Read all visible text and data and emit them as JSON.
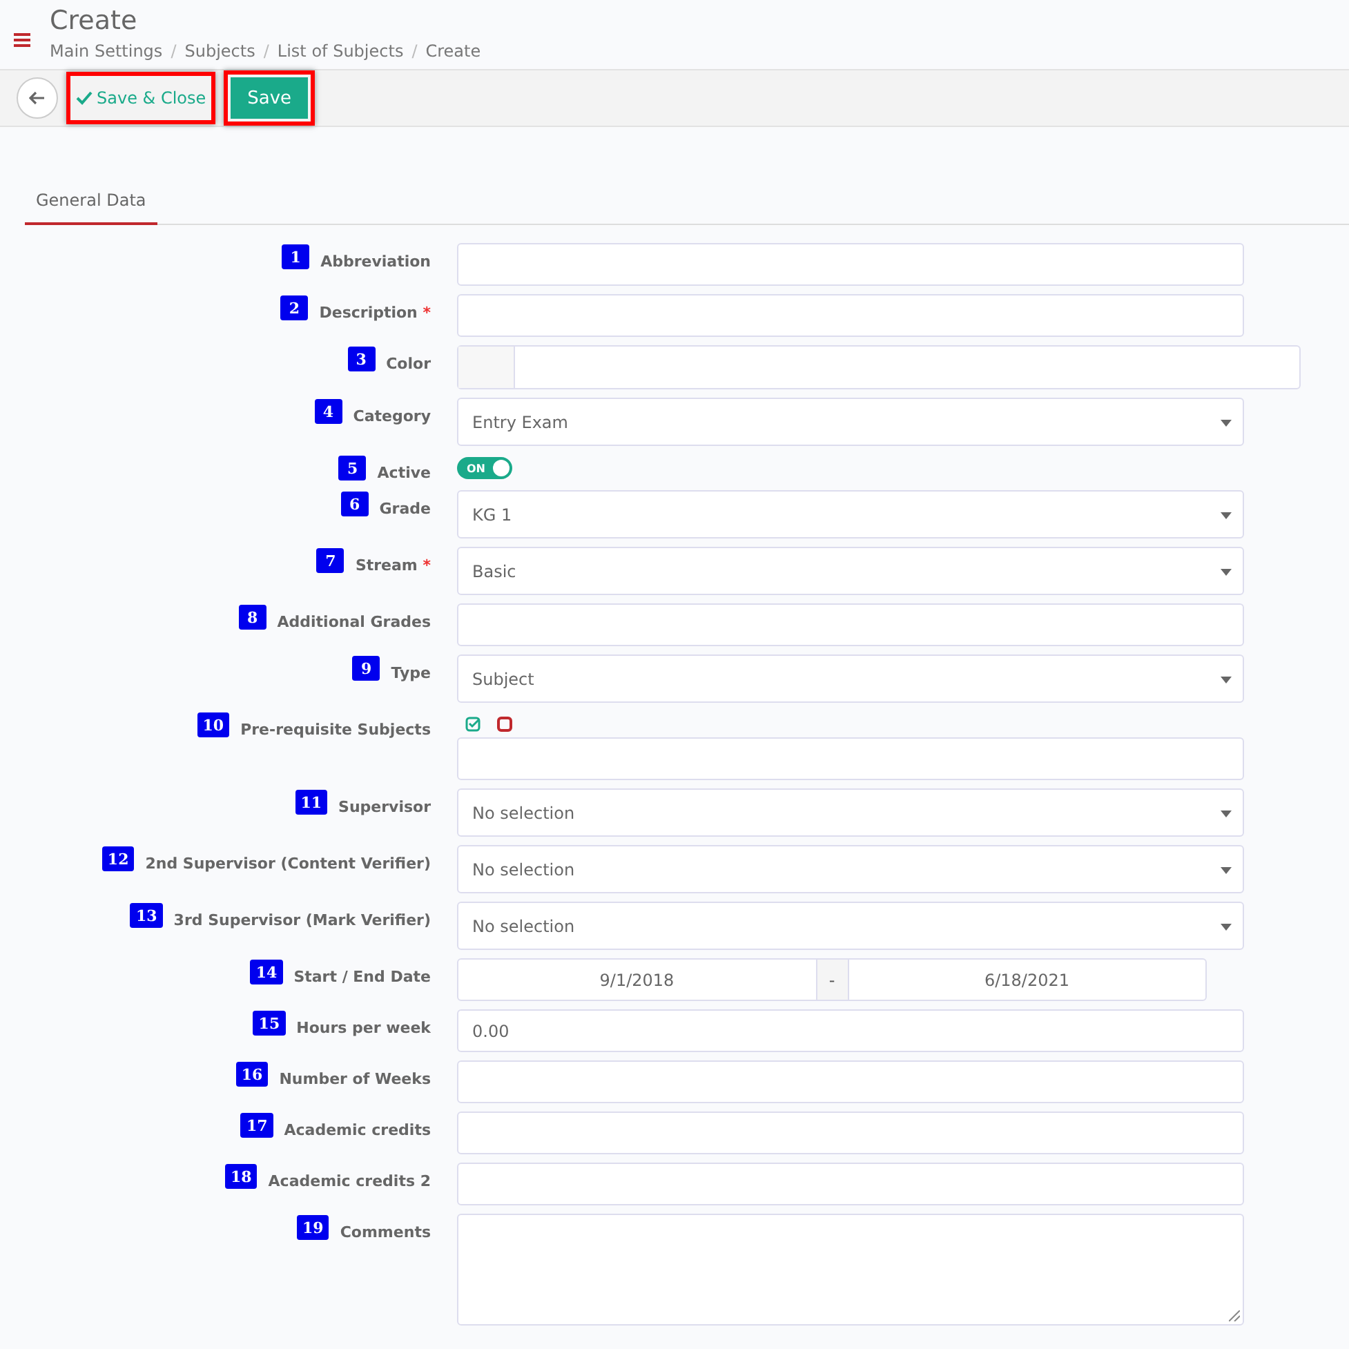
{
  "header": {
    "title": "Create",
    "breadcrumbs": [
      "Main Settings",
      "Subjects",
      "List of Subjects",
      "Create"
    ],
    "separator": "/"
  },
  "required_mark": "*",
  "toolbar": {
    "buttons": [
      {
        "kind": "back"
      },
      {
        "kind": "link",
        "label": "Save & Close"
      },
      {
        "kind": "primary",
        "label": "Save"
      }
    ]
  },
  "tabs": [
    {
      "label": "General Data",
      "selected": true
    }
  ],
  "fields": [
    {
      "number": "1",
      "label": "Abbreviation",
      "required": false,
      "kind": "text"
    },
    {
      "number": "2",
      "label": "Description",
      "required": true,
      "kind": "text"
    },
    {
      "number": "3",
      "label": "Color",
      "required": false,
      "kind": "color"
    },
    {
      "number": "4",
      "label": "Category",
      "required": false,
      "kind": "select",
      "value": "Entry Exam"
    },
    {
      "number": "5",
      "label": "Active",
      "required": false,
      "kind": "toggle",
      "on": true,
      "value": "ON"
    },
    {
      "number": "6",
      "label": "Grade",
      "required": false,
      "kind": "select",
      "value": "KG 1"
    },
    {
      "number": "7",
      "label": "Stream",
      "required": true,
      "kind": "select",
      "value": "Basic"
    },
    {
      "number": "8",
      "label": "Additional Grades",
      "required": false,
      "kind": "text"
    },
    {
      "number": "9",
      "label": "Type",
      "required": false,
      "kind": "select",
      "value": "Subject"
    },
    {
      "number": "10",
      "label": "Pre-requisite Subjects",
      "required": false,
      "kind": "checks"
    },
    {
      "number": "11",
      "label": "Supervisor",
      "required": false,
      "kind": "select",
      "value": "No selection"
    },
    {
      "number": "12",
      "label": "2nd Supervisor (Content Verifier)",
      "required": false,
      "kind": "select",
      "value": "No selection"
    },
    {
      "number": "13",
      "label": "3rd Supervisor (Mark Verifier)",
      "required": false,
      "kind": "select",
      "value": "No selection"
    },
    {
      "number": "14",
      "label": "Start / End Date",
      "required": false,
      "kind": "date",
      "start": "9/1/2018",
      "separator": "-",
      "end": "6/18/2021"
    },
    {
      "number": "15",
      "label": "Hours per week",
      "required": false,
      "kind": "text",
      "value": "0.00"
    },
    {
      "number": "16",
      "label": "Number of Weeks",
      "required": false,
      "kind": "text"
    },
    {
      "number": "17",
      "label": "Academic credits",
      "required": false,
      "kind": "text"
    },
    {
      "number": "18",
      "label": "Academic credits 2",
      "required": false,
      "kind": "text"
    },
    {
      "number": "19",
      "label": "Comments",
      "required": false,
      "kind": "textarea"
    }
  ]
}
